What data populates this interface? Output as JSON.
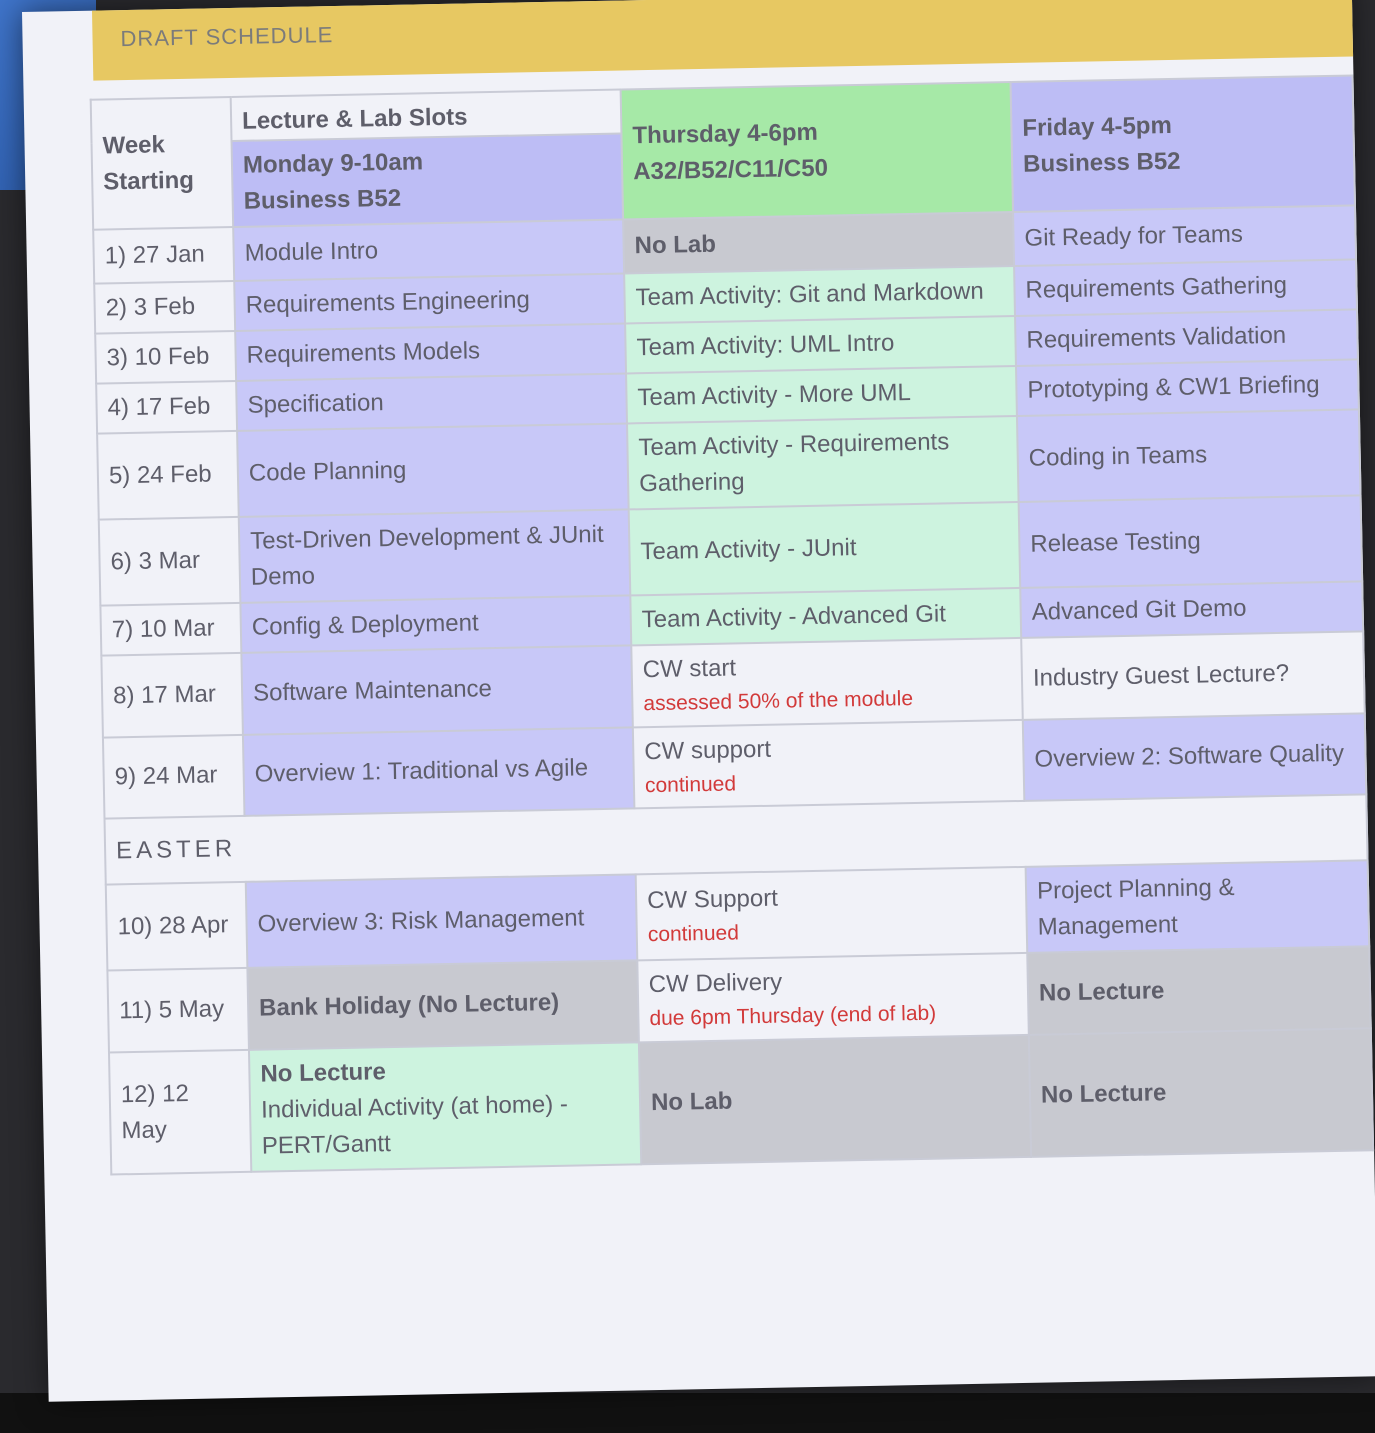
{
  "banner": "DRAFT SCHEDULE",
  "header": {
    "week": "Week",
    "starting": "Starting",
    "slots": "Lecture & Lab Slots",
    "monday_time": "Monday 9-10am",
    "monday_room": "Business B52",
    "thursday_time": "Thursday 4-6pm",
    "thursday_room": "A32/B52/C11/C50",
    "friday_time": "Friday 4-5pm",
    "friday_room": "Business B52"
  },
  "rows": [
    {
      "week": "1) 27 Jan",
      "mon": "Module Intro",
      "thu": "No Lab",
      "fri": "Git Ready for Teams"
    },
    {
      "week": "2) 3 Feb",
      "mon": "Requirements Engineering",
      "thu": "Team Activity: Git and Markdown",
      "fri": "Requirements Gathering"
    },
    {
      "week": "3) 10 Feb",
      "mon": "Requirements Models",
      "thu": "Team Activity: UML Intro",
      "fri": "Requirements Validation"
    },
    {
      "week": "4) 17 Feb",
      "mon": "Specification",
      "thu": "Team Activity - More UML",
      "fri": "Prototyping & CW1 Briefing"
    },
    {
      "week": "5) 24 Feb",
      "mon": "Code Planning",
      "thu": "Team Activity - Requirements Gathering",
      "fri": "Coding in Teams"
    },
    {
      "week": "6) 3 Mar",
      "mon": "Test-Driven Development & JUnit Demo",
      "thu": "Team Activity - JUnit",
      "fri": "Release Testing"
    },
    {
      "week": "7) 10 Mar",
      "mon": "Config & Deployment",
      "thu": "Team Activity - Advanced Git",
      "fri": "Advanced Git Demo"
    },
    {
      "week": "8) 17 Mar",
      "mon": "Software Maintenance",
      "thu": "CW start",
      "thu_note": "assessed 50% of the module",
      "fri": "Industry Guest Lecture?"
    },
    {
      "week": "9) 24 Mar",
      "mon": "Overview 1: Traditional vs Agile",
      "thu": "CW support",
      "thu_note": "continued",
      "fri": "Overview 2: Software Quality"
    }
  ],
  "easter": "EASTER",
  "rows2": [
    {
      "week": "10) 28 Apr",
      "mon": "Overview 3: Risk Management",
      "thu": "CW Support",
      "thu_note": "continued",
      "fri": "Project Planning & Management"
    },
    {
      "week": "11) 5 May",
      "mon": "Bank Holiday (No Lecture)",
      "thu": "CW Delivery",
      "thu_note": "due 6pm Thursday (end of lab)",
      "fri": "No Lecture"
    },
    {
      "week": "12) 12 May",
      "mon_title": "No Lecture",
      "mon": "Individual Activity (at home) - PERT/Gantt",
      "thu": "No Lab",
      "fri": "No Lecture"
    }
  ]
}
